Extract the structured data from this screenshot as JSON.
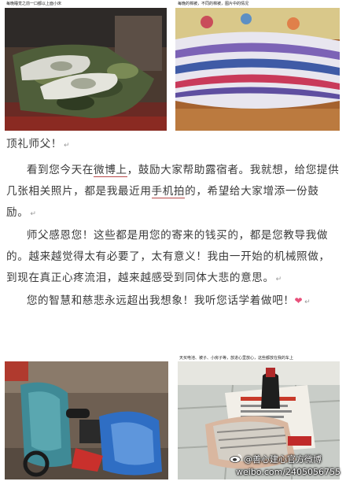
{
  "photo_captions": {
    "top_left": "每晚睡觉之前一口都以上面小床",
    "top_right": "每晚的棉被，不同的棉被，图片中的情况",
    "bottom_left": "",
    "bottom_right": "天买电池、被子、小房子等，放进心里放心，这些都放在我的车上"
  },
  "letter": {
    "greeting": "顶礼师父！",
    "p1_before": "看到您今天在",
    "p1_u1": "微博上",
    "p1_mid": "，鼓励大家帮助露宿者。我就想，给您提供几张相关照片，都是我最近用",
    "p1_u2": "手机拍",
    "p1_after": "的，希望给大家增添一份鼓励。",
    "p2": "师父感恩您！这些都是用您的寄来的钱买的，都是您教导我做的。越来越觉得太有必要了，太有意义！我由一开始的机械照做，到现在真正心疼流泪，越来越感受到同体大悲的意思。",
    "p3": "您的智慧和慈悲永远超出我想象！我听您话学着做吧！",
    "paragraph_mark": "↵",
    "heart": "❤"
  },
  "watermark": {
    "handle": "@善心建心官方微博",
    "url": "weibo.com/2405056755"
  }
}
